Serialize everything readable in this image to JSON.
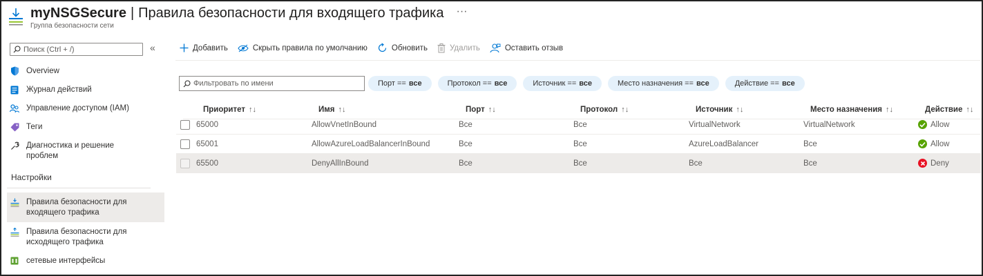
{
  "header": {
    "resource_name": "myNSGSecure",
    "separator": "|",
    "page_title": "Правила безопасности для входящего трафика",
    "more": "···",
    "subtitle": "Группа безопасности сети"
  },
  "sidebar": {
    "search_placeholder": "Поиск (Ctrl + /)",
    "collapse": "«",
    "items": [
      {
        "label": "Overview",
        "icon": "shield-icon"
      },
      {
        "label": "Журнал действий",
        "icon": "activity-log-icon"
      },
      {
        "label": "Управление доступом (IAM)",
        "icon": "people-icon"
      },
      {
        "label": "Теги",
        "icon": "tag-icon"
      },
      {
        "label": "Диагностика и решение проблем",
        "icon": "wrench-icon"
      }
    ],
    "section_title": "Настройки",
    "settings_items": [
      {
        "label": "Правила безопасности для входящего трафика",
        "icon": "inbound-rules-icon",
        "active": true
      },
      {
        "label": "Правила безопасности для исходящего трафика",
        "icon": "outbound-rules-icon",
        "active": false
      },
      {
        "label": "сетевые интерфейсы",
        "icon": "network-interface-icon",
        "active": false
      }
    ]
  },
  "toolbar": {
    "add": "Добавить",
    "hide_defaults": "Скрыть правила по умолчанию",
    "refresh": "Обновить",
    "delete": "Удалить",
    "feedback": "Оставить отзыв"
  },
  "filters": {
    "name_placeholder": "Фильтровать по имени",
    "pills": [
      {
        "key": "Порт ==",
        "value": "все"
      },
      {
        "key": "Протокол ==",
        "value": "все"
      },
      {
        "key": "Источник ==",
        "value": "все"
      },
      {
        "key": "Место назначения ==",
        "value": "все"
      },
      {
        "key": "Действие ==",
        "value": "все"
      }
    ]
  },
  "table": {
    "columns": [
      "Приоритет",
      "Имя",
      "Порт",
      "Протокол",
      "Источник",
      "Место назначения",
      "Действие"
    ],
    "rows": [
      {
        "priority": "65000",
        "name": "AllowVnetInBound",
        "port": "Все",
        "protocol": "Все",
        "source": "VirtualNetwork",
        "destination": "VirtualNetwork",
        "action": "Allow",
        "selected": false
      },
      {
        "priority": "65001",
        "name": "AllowAzureLoadBalancerInBound",
        "port": "Все",
        "protocol": "Все",
        "source": "AzureLoadBalancer",
        "destination": "Все",
        "action": "Allow",
        "selected": false
      },
      {
        "priority": "65500",
        "name": "DenyAllInBound",
        "port": "Все",
        "protocol": "Все",
        "source": "Все",
        "destination": "Все",
        "action": "Deny",
        "selected": true
      }
    ]
  },
  "colors": {
    "accent": "#0078d4",
    "allow": "#57a300",
    "deny": "#e81123",
    "pill_bg": "#e5f1fb",
    "selected_row": "#edebe9"
  }
}
